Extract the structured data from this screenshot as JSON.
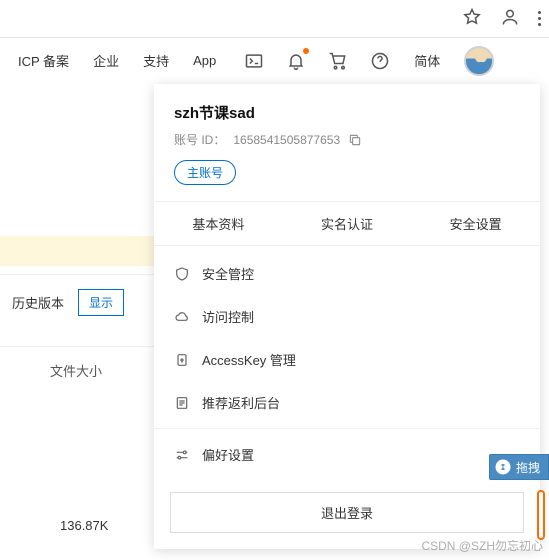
{
  "nav": {
    "items": [
      "ICP 备案",
      "企业",
      "支持",
      "App"
    ],
    "lang": "简体"
  },
  "background": {
    "history": "历史版本",
    "show": "显示",
    "filesize_label": "文件大小",
    "filesize_value": "136.87K"
  },
  "panel": {
    "title": "szh节课sad",
    "id_label": "账号 ID：",
    "id_value": "1658541505877653",
    "badge": "主账号",
    "tabs": [
      "基本资料",
      "实名认证",
      "安全设置"
    ],
    "menu": [
      {
        "icon": "shield-icon",
        "label": "安全管控"
      },
      {
        "icon": "cloud-icon",
        "label": "访问控制"
      },
      {
        "icon": "key-icon",
        "label": "AccessKey 管理"
      },
      {
        "icon": "list-icon",
        "label": "推荐返利后台"
      }
    ],
    "prefs": {
      "icon": "sliders-icon",
      "label": "偏好设置"
    },
    "logout": "退出登录"
  },
  "float": {
    "label": "拖拽"
  },
  "watermark": "CSDN @SZH勿忘初心"
}
